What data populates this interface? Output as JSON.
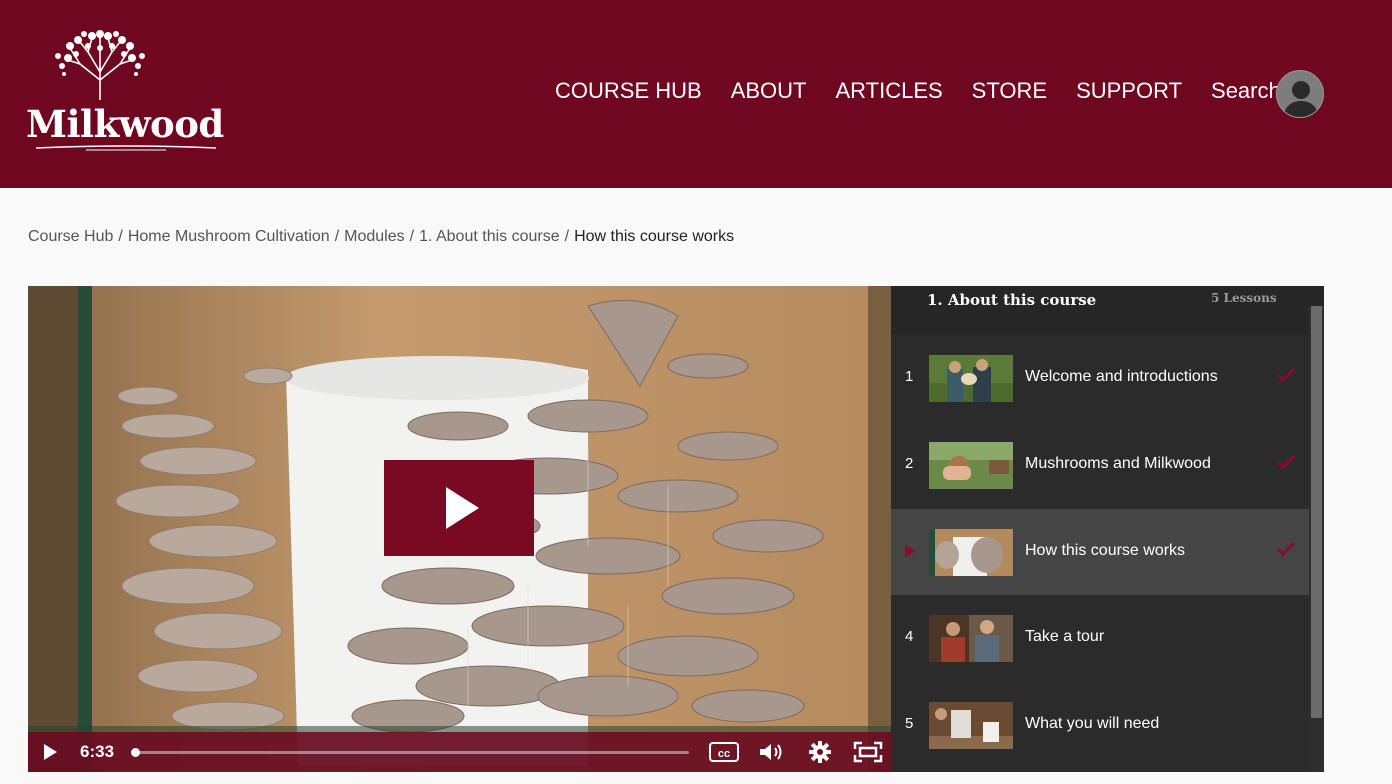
{
  "brand": {
    "logo_text": "Milkwood",
    "color": "#700721"
  },
  "nav": {
    "items": [
      {
        "label": "COURSE HUB"
      },
      {
        "label": "ABOUT"
      },
      {
        "label": "ARTICLES"
      },
      {
        "label": "STORE"
      },
      {
        "label": "SUPPORT"
      },
      {
        "label": "Search"
      }
    ],
    "avatar_icon": "user-avatar-icon"
  },
  "breadcrumb": {
    "items": [
      {
        "label": "Course Hub"
      },
      {
        "label": "Home Mushroom Cultivation"
      },
      {
        "label": "Modules"
      },
      {
        "label": "1. About this course"
      }
    ],
    "separator": "/",
    "current": "How this course works"
  },
  "video": {
    "time": "6:33",
    "progress": 0.005,
    "icons": [
      "play-icon",
      "captions-icon",
      "volume-icon",
      "settings-icon",
      "fullscreen-icon"
    ]
  },
  "module": {
    "title": "1. About this course",
    "lesson_count": "5 Lessons",
    "lessons": [
      {
        "number": "1",
        "title": "Welcome and introductions",
        "completed": true,
        "active": false
      },
      {
        "number": "2",
        "title": "Mushrooms and Milkwood",
        "completed": true,
        "active": false
      },
      {
        "number": "",
        "title": "How this course works",
        "completed": true,
        "active": true
      },
      {
        "number": "4",
        "title": "Take a tour",
        "completed": false,
        "active": false
      },
      {
        "number": "5",
        "title": "What you will need",
        "completed": false,
        "active": false
      }
    ]
  }
}
